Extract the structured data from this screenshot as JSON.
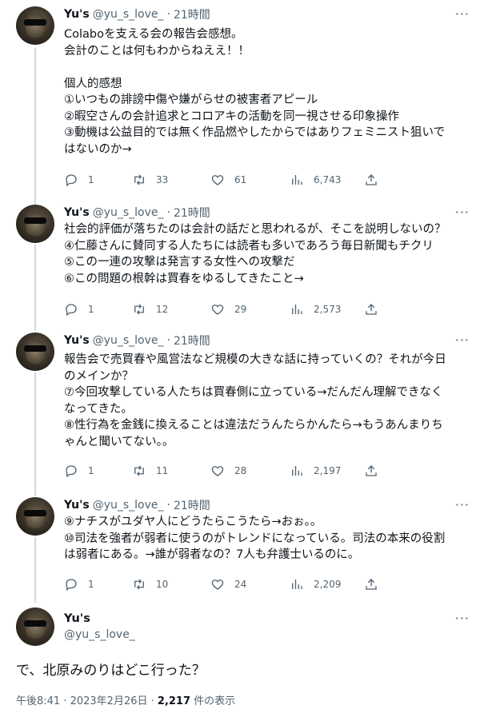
{
  "tweets": [
    {
      "name": "Yu's",
      "handle": "@yu_s_love_",
      "dot": "·",
      "time": "21時間",
      "text": "Colaboを支える会の報告会感想。\n会計のことは何もわからねええ！！\n\n個人的感想\n①いつもの誹謗中傷や嫌がらせの被害者アピール\n②暇空さんの会計追求とコロアキの活動を同一視させる印象操作\n③動機は公益目的では無く作品燃やしたからではありフェミニスト狙いで\nはないのか→",
      "replies": "1",
      "retweets": "33",
      "likes": "61",
      "views": "6,743"
    },
    {
      "name": "Yu's",
      "handle": "@yu_s_love_",
      "dot": "·",
      "time": "21時間",
      "text": "社会的評価が落ちたのは会計の話だと思われるが、そこを説明しないの？\n④仁藤さんに賛同する人たちには読者も多いであろう毎日新聞もチクリ\n⑤この一連の攻撃は発言する女性への攻撃だ\n⑥この問題の根幹は買春をゆるしてきたこと→",
      "replies": "1",
      "retweets": "12",
      "likes": "29",
      "views": "2,573"
    },
    {
      "name": "Yu's",
      "handle": "@yu_s_love_",
      "dot": "·",
      "time": "21時間",
      "text": "報告会で売買春や風営法など規模の大きな話に持っていくの？それが今日\nのメインか？\n⑦今回攻撃している人たちは買春側に立っている→だんだん理解できなく\nなってきた。\n⑧性行為を金銭に換えることは違法だうんたらかんたら→もうあんまりち\nゃんと聞いてない。。",
      "replies": "1",
      "retweets": "11",
      "likes": "28",
      "views": "2,197"
    },
    {
      "name": "Yu's",
      "handle": "@yu_s_love_",
      "dot": "·",
      "time": "21時間",
      "text": "⑨ナチスがユダヤ人にどうたらこうたら→おぉ。。\n⑩司法を強者が弱者に使うのがトレンドになっている。司法の本来の役割\nは弱者にある。→誰が弱者なの？7人も弁護士いるのに。",
      "replies": "1",
      "retweets": "10",
      "likes": "24",
      "views": "2,209"
    }
  ],
  "main": {
    "name": "Yu's",
    "handle": "@yu_s_love_",
    "text": "で、北原みのりはどこ行った？",
    "time": "午後8:41 · 2023年2月26日 · ",
    "views_count": "2,217",
    "views_label": " 件の表示"
  },
  "more_label": "···"
}
